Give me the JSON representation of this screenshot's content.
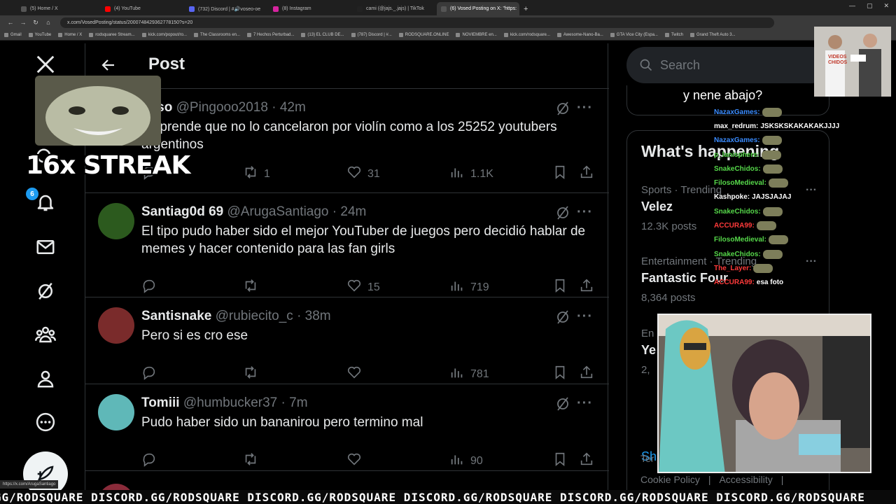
{
  "browser": {
    "tabs": [
      {
        "label": "(5) Home / X",
        "color": "#555555",
        "active": false
      },
      {
        "label": "(4) YouTube",
        "color": "#ff0000",
        "active": false
      },
      {
        "label": "(732) Discord | #🔊voseo-oe",
        "color": "#5865f2",
        "active": false
      },
      {
        "label": "(8) Instagram",
        "color": "#d6249f",
        "active": false
      },
      {
        "label": "cami (@jajs._.jajs) | TikTok",
        "color": "#222222",
        "active": false
      },
      {
        "label": "(6) Vosed Posting on X: \"https:",
        "color": "#555555",
        "active": true
      }
    ],
    "url": "x.com/VosedPosting/status/2000748429362778150?s=20",
    "bookmarks": [
      "Gmail",
      "YouTube",
      "Home / X",
      "rodsquaree Stream...",
      "kick.com/popout/ro...",
      "The Classrooms en...",
      "7 Hechos Perturbad...",
      "(13) EL CLUB DE...",
      "(787) Discord | #...",
      "RODSQUARE.ONLINE",
      "NOVIEMBRE en...",
      "kick.com/rodsquare...",
      "Awesome-Nano-Ba...",
      "GTA Vice City (Espa...",
      "Twitch",
      "Grand Theft Auto 3..."
    ],
    "status_url": "https://x.com/ArugaSantiago"
  },
  "nav": {
    "notification_count": "6"
  },
  "header": {
    "title": "Post"
  },
  "replies": [
    {
      "name": "gaso",
      "handle": "@Pingooo2018",
      "time": "· 42m",
      "text": "sorprende que no lo cancelaron por violín como a los 25252 youtubers argentinos",
      "reposts": "1",
      "likes": "31",
      "views": "1.1K",
      "avatar_color": "#6b6b5c"
    },
    {
      "name": "Santiag0d 69",
      "handle": "@ArugaSantiago",
      "time": "· 24m",
      "text": "El tipo pudo haber sido el mejor YouTuber de juegos pero decidió hablar de memes y hacer contenido para las fan girls",
      "reposts": "",
      "likes": "15",
      "views": "719",
      "avatar_color": "#2c5a1e"
    },
    {
      "name": "Santisnake",
      "handle": "@rubiecito_c",
      "time": "· 38m",
      "text": "Pero si es cro ese",
      "reposts": "",
      "likes": "",
      "views": "781",
      "avatar_color": "#7a2b2b"
    },
    {
      "name": "Tomiii",
      "handle": "@humbucker37",
      "time": "· 7m",
      "text": "Pudo haber sido un bananirou pero termino mal",
      "reposts": "",
      "likes": "",
      "views": "90",
      "avatar_color": "#5fb8b8"
    }
  ],
  "right": {
    "search_placeholder": "Search",
    "trends_title": "What's happening",
    "trends": [
      {
        "category": "Sports · Trending",
        "name": "Velez",
        "posts": "12.3K posts"
      },
      {
        "category": "Entertainment · Trending",
        "name": "Fantastic Four",
        "posts": "8,364 posts"
      },
      {
        "category": "En",
        "name": "Ye",
        "posts": "2,"
      }
    ],
    "show_more": "Sh",
    "footer": [
      "Ter",
      "Cookie Policy",
      "|",
      "Accessibility",
      "|"
    ]
  },
  "overlay": {
    "streak": "16x STREAK",
    "chat_question": "y nene abajo?",
    "chat": [
      {
        "user": "NazaxGames:",
        "color": "#3a8cff",
        "msg": "",
        "emote": true
      },
      {
        "user": "max_redrum:",
        "color": "#ffffff",
        "msg": "JSKSKSKAKAKAKJJJJ",
        "emote": false
      },
      {
        "user": "NazaxGames:",
        "color": "#3a8cff",
        "msg": "",
        "emote": true
      },
      {
        "user": "p_lanisphere:",
        "color": "#56d84a",
        "msg": "",
        "emote": true
      },
      {
        "user": "SnakeChidos:",
        "color": "#56d84a",
        "msg": "",
        "emote": true
      },
      {
        "user": "FilosoMedieval:",
        "color": "#56d84a",
        "msg": "",
        "emote": true
      },
      {
        "user": "Kashpoke:",
        "color": "#ffffff",
        "msg": "JAJSJAJAJ",
        "emote": false
      },
      {
        "user": "SnakeChidos:",
        "color": "#56d84a",
        "msg": "",
        "emote": true
      },
      {
        "user": "ACCURA99:",
        "color": "#ff3a3a",
        "msg": "",
        "emote": true
      },
      {
        "user": "FilosoMedieval:",
        "color": "#56d84a",
        "msg": "",
        "emote": true
      },
      {
        "user": "SnakeChidos:",
        "color": "#56d84a",
        "msg": "",
        "emote": true
      },
      {
        "user": "The_Layer:",
        "color": "#ff3a3a",
        "msg": "",
        "emote": true
      },
      {
        "user": "ACCURA99:",
        "color": "#ff3a3a",
        "msg": "esa foto",
        "emote": false
      }
    ],
    "ticker": "RD.GG/RODSQUARE DISCORD.GG/RODSQUARE DISCORD.GG/RODSQUARE DISCORD.GG/RODSQUARE DISCORD.GG/RODSQUARE DISCORD.GG/RODSQUARE",
    "clip_caption": "VIDEOS CHIDOS"
  },
  "colors": {
    "accent": "#1d9bf0",
    "background": "#000000",
    "border": "#2f3336",
    "muted": "#71767b"
  }
}
